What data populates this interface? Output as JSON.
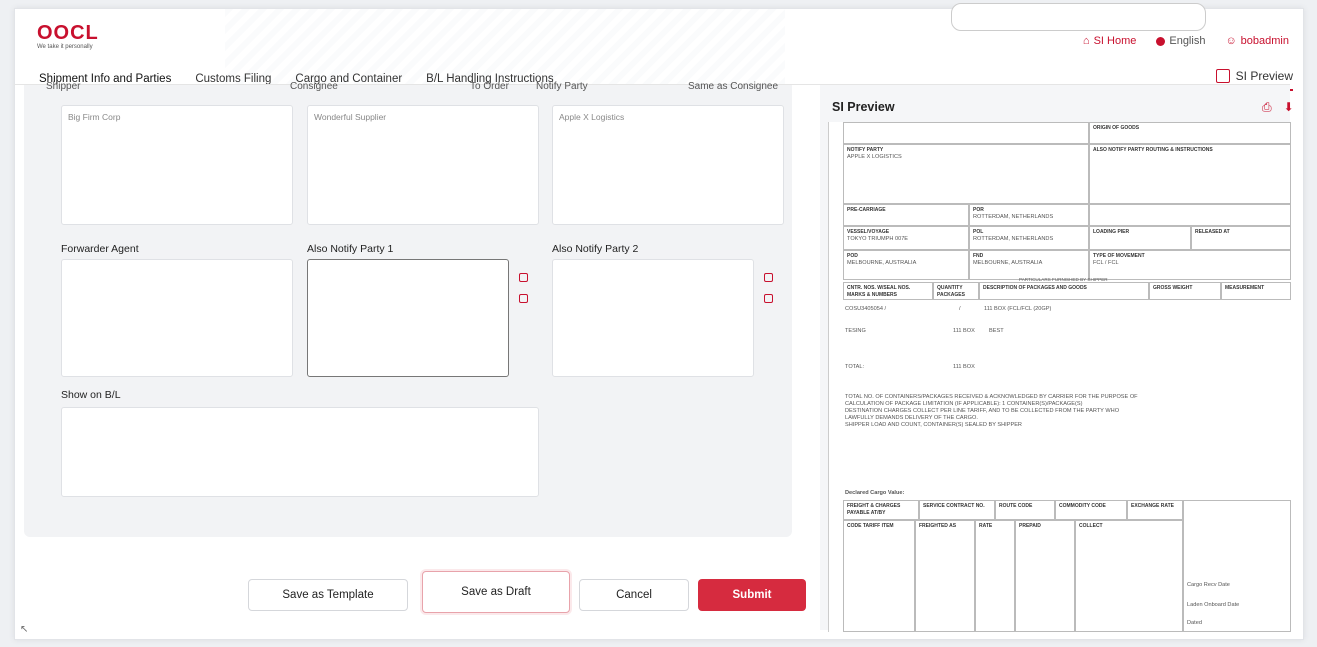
{
  "brand": {
    "name": "OOCL",
    "tagline": "We take it personally"
  },
  "topnav": {
    "home": "SI Home",
    "language": "English",
    "user": "bobadmin"
  },
  "tabs": [
    "Shipment Info and Parties",
    "Customs Filing",
    "Cargo and Container",
    "B/L Handling Instructions"
  ],
  "preview_tab": "SI Preview",
  "form": {
    "top_labels": {
      "shipper": "Shipper",
      "consignee": "Consignee",
      "to_order": "To Order",
      "notify": "Notify Party",
      "same_as": "Same as Consignee"
    },
    "shipper_value": "Big Firm Corp",
    "consignee_value": "Wonderful Supplier",
    "notify_value": "Apple X Logistics",
    "forwarder_label": "Forwarder Agent",
    "also_notify_1": "Also Notify Party 1",
    "also_notify_2": "Also Notify Party 2",
    "show_on_bl": "Show on B/L"
  },
  "buttons": {
    "template": "Save as Template",
    "draft": "Save as Draft",
    "cancel": "Cancel",
    "submit": "Submit"
  },
  "preview": {
    "title": "SI Preview",
    "origin": "ORIGIN OF GOODS",
    "notify_party": "NOTIFY PARTY",
    "notify_value": "APPLE X LOGISTICS",
    "also_notify": "ALSO NOTIFY PARTY ROUTING & INSTRUCTIONS",
    "precarriage": "PRE-CARRIAGE",
    "por": "POR",
    "por_value": "ROTTERDAM, NETHERLANDS",
    "vessel": "VESSEL/VOYAGE",
    "vessel_value": "TOKYO TRIUMPH 007E",
    "pol": "POL",
    "pol_value": "ROTTERDAM, NETHERLANDS",
    "loading_pier": "LOADING PIER",
    "released_at": "RELEASED AT",
    "pod": "POD",
    "pod_value": "MELBOURNE, AUSTRALIA",
    "fnd": "FND",
    "fnd_value": "MELBOURNE, AUSTRALIA",
    "movement": "TYPE OF MOVEMENT",
    "movement_value": "FCL / FCL",
    "particulars": "PARTICULARS FURNISHED BY SHIPPER",
    "col_marks": "CNTR. NOS. W/SEAL NOS. MARKS & NUMBERS",
    "col_qty": "QUANTITY PACKAGES",
    "col_desc": "DESCRIPTION OF PACKAGES AND GOODS",
    "col_weight": "GROSS WEIGHT",
    "col_meas": "MEASUREMENT",
    "row1_cntr": "COSU3405054 /",
    "row1_slash": "/",
    "row1_desc": "111 BOX (FCL/FCL (20GP)",
    "row2_mark": "TESING",
    "row2_qty": "111 BOX",
    "row2_desc": "BEST",
    "total": "TOTAL:",
    "total_qty": "111 BOX",
    "clause1": "TOTAL NO. OF CONTAINERS/PACKAGES RECEIVED & ACKNOWLEDGED BY CARRIER FOR THE PURPOSE OF",
    "clause2": "CALCULATION OF PACKAGE LIMITATION (IF APPLICABLE): 1 CONTAINER(S)/PACKAGE(S)",
    "clause3": "DESTINATION CHARGES COLLECT PER LINE TARIFF, AND TO BE COLLECTED FROM THE PARTY WHO",
    "clause4": "LAWFULLY DEMANDS DELIVERY OF THE CARGO.",
    "clause5": "SHIPPER LOAD AND COUNT, CONTAINER(S) SEALED BY SHIPPER",
    "declared": "Declared Cargo Value:",
    "freight": "FREIGHT & CHARGES PAYABLE AT/BY",
    "service_contract": "SERVICE CONTRACT NO.",
    "route_code": "ROUTE CODE",
    "commodity": "COMMODITY CODE",
    "exchange": "EXCHANGE RATE",
    "code_tariff": "CODE TARIFF ITEM",
    "freighted_as": "FREIGHTED AS",
    "rate": "RATE",
    "prepaid": "PREPAID",
    "collect": "COLLECT",
    "cargo_recv": "Cargo Recv Date",
    "laden": "Laden Onboard Date",
    "dated": "Dated"
  }
}
